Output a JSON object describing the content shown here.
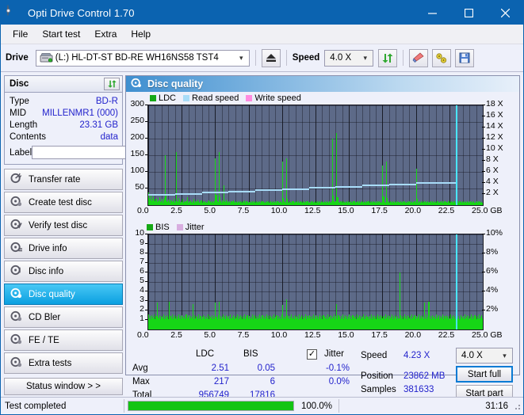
{
  "window": {
    "title": "Opti Drive Control 1.70",
    "icon": "disc-icon",
    "minimize": "minimize",
    "maximize": "maximize",
    "close": "close"
  },
  "menu": [
    "File",
    "Start test",
    "Extra",
    "Help"
  ],
  "toolbar": {
    "drive_label": "Drive",
    "drive_value": "(L:)  HL-DT-ST BD-RE  WH16NS58 TST4",
    "eject": "eject",
    "speed_label": "Speed",
    "speed_value": "4.0 X",
    "refresh": "refresh",
    "erase": "erase",
    "tools": "tools",
    "save": "save"
  },
  "disc_panel": {
    "title": "Disc",
    "refresh": "refresh",
    "rows": [
      {
        "key": "Type",
        "value": "BD-R"
      },
      {
        "key": "MID",
        "value": "MILLENMR1 (000)"
      },
      {
        "key": "Length",
        "value": "23.31 GB"
      },
      {
        "key": "Contents",
        "value": "data"
      }
    ],
    "label_key": "Label",
    "label_value": "",
    "label_placeholder": ""
  },
  "nav": [
    {
      "label": "Transfer rate",
      "selected": false
    },
    {
      "label": "Create test disc",
      "selected": false
    },
    {
      "label": "Verify test disc",
      "selected": false
    },
    {
      "label": "Drive info",
      "selected": false
    },
    {
      "label": "Disc info",
      "selected": false
    },
    {
      "label": "Disc quality",
      "selected": true
    },
    {
      "label": "CD Bler",
      "selected": false
    },
    {
      "label": "FE / TE",
      "selected": false
    },
    {
      "label": "Extra tests",
      "selected": false
    }
  ],
  "status_window_button": "Status window > >",
  "main": {
    "title": "Disc quality"
  },
  "stats": {
    "col_ldc": "LDC",
    "col_bis": "BIS",
    "jitter_label": "Jitter",
    "jitter_checked": true,
    "rows": [
      {
        "label": "Avg",
        "ldc": "2.51",
        "bis": "0.05",
        "jitter": "-0.1%"
      },
      {
        "label": "Max",
        "ldc": "217",
        "bis": "6",
        "jitter": "0.0%"
      },
      {
        "label": "Total",
        "ldc": "956749",
        "bis": "17816",
        "jitter": ""
      }
    ],
    "speed_label": "Speed",
    "speed_value": "4.23 X",
    "position_label": "Position",
    "position_value": "23862 MB",
    "samples_label": "Samples",
    "samples_value": "381633",
    "speed_select": "4.0 X",
    "start_full": "Start full",
    "start_part": "Start part"
  },
  "statusbar": {
    "message": "Test completed",
    "percent_text": "100.0%",
    "percent_value": 100,
    "elapsed": "31:16"
  },
  "colors": {
    "accent": "#0b63b0",
    "ldc": "#16d616",
    "bis": "#16d616",
    "read_speed": "#a8dcf8",
    "write_speed": "#ff8ce0",
    "jitter": "#d8aee0",
    "plot_bg": "#5d6a88",
    "cursor": "#49e6ff",
    "value_text": "#2222cc",
    "progress": "#13c413"
  },
  "chart_data": [
    {
      "type": "bar",
      "name": "ldc-chart",
      "title": "",
      "xlabel": "GB",
      "ylabel": "",
      "legend": [
        {
          "label": "LDC",
          "color": "#16d616"
        },
        {
          "label": "Read speed",
          "color": "#a8dcf8"
        },
        {
          "label": "Write speed",
          "color": "#ff8ce0"
        }
      ],
      "legend_position": "top-left",
      "grid": true,
      "xlim": [
        0.0,
        25.0
      ],
      "ylim": [
        0,
        300
      ],
      "xticks": [
        "0.0",
        "2.5",
        "5.0",
        "7.5",
        "10.0",
        "12.5",
        "15.0",
        "17.5",
        "20.0",
        "22.5",
        "25.0"
      ],
      "xtick_values": [
        0.0,
        2.5,
        5.0,
        7.5,
        10.0,
        12.5,
        15.0,
        17.5,
        20.0,
        22.5,
        25.0
      ],
      "x_unit": "GB",
      "yticks": [
        "300",
        "250",
        "200",
        "150",
        "100",
        "50"
      ],
      "ytick_values": [
        300,
        250,
        200,
        150,
        100,
        50
      ],
      "y2label": "",
      "y2lim": [
        0,
        18
      ],
      "y2ticks": [
        "18 X",
        "16 X",
        "14 X",
        "12 X",
        "10 X",
        "8 X",
        "6 X",
        "4 X",
        "2 X"
      ],
      "y2tick_values": [
        18,
        16,
        14,
        12,
        10,
        8,
        6,
        4,
        2
      ],
      "cursor_x": 23.0,
      "series": [
        {
          "name": "LDC",
          "color": "#16d616",
          "values": [
            38,
            22,
            16,
            30,
            12,
            18,
            26,
            14,
            11,
            20,
            9,
            15,
            13,
            24,
            10,
            12,
            19,
            8,
            14,
            22,
            150,
            28,
            12,
            9,
            17,
            11,
            8,
            14,
            10,
            12,
            19,
            7,
            13,
            160,
            11,
            9,
            22,
            14,
            8,
            12,
            10,
            18,
            7,
            13,
            9,
            11,
            25,
            8,
            12,
            10,
            14,
            9,
            7,
            12,
            19,
            8,
            11,
            13,
            9,
            16,
            12,
            7,
            10,
            14,
            8,
            11,
            9,
            13,
            7,
            10,
            8,
            12,
            15,
            9,
            11,
            7,
            10,
            13,
            8,
            12,
            140,
            30,
            12,
            9,
            160,
            25,
            11,
            8,
            14,
            10,
            60,
            12,
            9,
            16,
            11,
            8,
            13,
            10,
            7,
            12,
            9,
            14,
            11,
            8,
            10,
            12,
            7,
            9,
            13,
            8,
            11,
            10,
            7,
            12,
            9,
            14,
            8,
            11,
            9,
            7,
            10,
            12,
            8,
            9,
            11,
            7,
            13,
            10,
            8,
            12,
            9,
            7,
            11,
            10,
            8,
            13,
            9,
            12,
            7,
            10,
            8,
            11,
            9,
            13,
            7,
            10,
            12,
            8,
            9,
            11,
            7,
            10,
            13,
            8,
            12,
            9,
            7,
            11,
            10,
            8,
            130,
            22,
            9,
            11,
            7,
            140,
            18,
            10,
            8,
            12,
            9,
            7,
            11,
            13,
            8,
            10,
            9,
            12,
            7,
            11,
            8,
            10,
            13,
            9,
            7,
            12,
            10,
            8,
            11,
            9,
            13,
            7,
            10,
            8,
            12,
            9,
            11,
            7,
            10,
            13,
            8,
            9,
            12,
            7,
            11,
            10,
            8,
            13,
            9,
            7,
            12,
            10,
            8,
            11,
            9,
            7,
            13,
            10,
            8,
            12,
            200,
            28,
            12,
            9,
            11,
            217,
            24,
            10,
            8,
            13,
            9,
            11,
            7,
            12,
            10,
            8,
            9,
            13,
            7,
            11,
            10,
            8,
            12,
            9,
            7,
            11,
            13,
            8,
            10,
            9,
            12,
            7,
            11,
            8,
            10,
            13,
            9,
            7,
            12,
            10,
            8,
            11,
            9,
            13,
            7,
            10,
            12,
            8,
            9,
            11,
            10,
            7,
            13,
            8,
            12,
            9,
            11,
            7,
            10,
            8,
            120,
            26,
            10,
            8,
            130,
            22,
            9,
            12,
            7,
            11,
            10,
            8,
            13,
            9,
            7,
            12,
            10,
            8,
            11,
            9,
            7,
            13,
            10,
            8,
            12,
            9,
            11,
            7,
            10,
            8,
            13,
            9,
            12,
            7,
            11,
            10,
            8,
            9,
            13,
            7,
            110,
            20,
            8,
            11,
            9,
            7,
            13,
            10,
            8,
            12,
            9,
            11,
            7,
            10,
            13,
            8,
            9,
            12,
            7,
            11,
            10,
            8,
            13,
            9,
            7,
            12,
            11,
            8,
            10,
            9,
            13,
            7,
            11,
            8,
            12,
            10,
            9,
            7,
            13,
            11,
            8,
            10,
            12,
            9,
            7,
            11,
            13,
            8,
            10,
            9,
            12,
            7,
            11,
            10,
            8,
            13,
            9,
            7,
            12,
            10,
            8,
            11,
            9,
            7,
            13,
            10,
            12,
            8,
            9,
            11,
            7,
            10,
            13,
            8,
            12,
            9,
            11,
            7,
            10,
            8
          ]
        },
        {
          "name": "Read speed",
          "color": "#a8dcf8",
          "note": "stepped CAV read curve rising from about 2.0 X to about 4.3 X",
          "x": [
            0.0,
            2.0,
            4.0,
            6.0,
            8.0,
            10.0,
            12.0,
            14.0,
            16.0,
            18.0,
            20.0,
            22.0,
            23.0
          ],
          "values": [
            2.0,
            2.2,
            2.4,
            2.6,
            2.8,
            3.0,
            3.3,
            3.5,
            3.7,
            3.9,
            4.1,
            4.2,
            4.23
          ]
        }
      ]
    },
    {
      "type": "bar",
      "name": "bis-chart",
      "title": "",
      "xlabel": "GB",
      "ylabel": "",
      "legend": [
        {
          "label": "BIS",
          "color": "#16d616"
        },
        {
          "label": "Jitter",
          "color": "#d8aee0"
        }
      ],
      "legend_position": "top-left",
      "grid": true,
      "xlim": [
        0.0,
        25.0
      ],
      "ylim": [
        0,
        10
      ],
      "xticks": [
        "0.0",
        "2.5",
        "5.0",
        "7.5",
        "10.0",
        "12.5",
        "15.0",
        "17.5",
        "20.0",
        "22.5",
        "25.0"
      ],
      "xtick_values": [
        0.0,
        2.5,
        5.0,
        7.5,
        10.0,
        12.5,
        15.0,
        17.5,
        20.0,
        22.5,
        25.0
      ],
      "x_unit": "GB",
      "yticks": [
        "10",
        "9",
        "8",
        "7",
        "6",
        "5",
        "4",
        "3",
        "2",
        "1"
      ],
      "ytick_values": [
        10,
        9,
        8,
        7,
        6,
        5,
        4,
        3,
        2,
        1
      ],
      "y2lim": [
        0,
        10
      ],
      "y2ticks": [
        "10%",
        "8%",
        "6%",
        "4%",
        "2%"
      ],
      "y2tick_values": [
        10,
        8,
        6,
        4,
        2
      ],
      "cursor_x": 23.0,
      "series": [
        {
          "name": "BIS",
          "color": "#16d616",
          "values": [
            1.6,
            1.2,
            1.4,
            1.1,
            1.5,
            1.3,
            1.2,
            1.6,
            1.1,
            1.4,
            2.8,
            1.3,
            1.2,
            1.5,
            1.1,
            1.4,
            1.3,
            1.2,
            1.6,
            1.1,
            1.4,
            1.2,
            1.5,
            1.3,
            1.1,
            2.9,
            1.4,
            1.2,
            1.6,
            1.1,
            1.3,
            1.5,
            1.2,
            1.4,
            1.1,
            1.3,
            1.6,
            1.2,
            1.4,
            1.1,
            1.5,
            1.3,
            1.2,
            1.4,
            1.1,
            1.6,
            1.2,
            1.3,
            1.5,
            1.1,
            1.4,
            1.2,
            1.3,
            2.7,
            1.1,
            1.5,
            1.2,
            1.4,
            1.3,
            1.1,
            1.6,
            1.2,
            1.4,
            1.1,
            1.3,
            1.5,
            1.2,
            1.4,
            1.1,
            1.3,
            1.2,
            1.6,
            1.1,
            1.4,
            1.3,
            1.2,
            1.5,
            1.1,
            1.4,
            1.2,
            2.8,
            1.3,
            1.1,
            1.5,
            2.9,
            1.2,
            1.4,
            1.1,
            1.3,
            1.6,
            1.2,
            1.4,
            1.1,
            1.5,
            1.3,
            1.2,
            1.4,
            1.1,
            1.6,
            1.2,
            1.3,
            1.5,
            1.1,
            1.4,
            1.2,
            1.3,
            1.6,
            1.1,
            1.4,
            1.2,
            1.5,
            1.3,
            1.1,
            1.4,
            1.2,
            1.6,
            1.1,
            1.3,
            1.5,
            1.2,
            1.4,
            1.1,
            1.3,
            1.2,
            1.6,
            1.1,
            1.4,
            1.5,
            1.2,
            1.3,
            1.1,
            1.4,
            1.2,
            1.6,
            1.3,
            1.1,
            1.5,
            1.2,
            1.4,
            1.1,
            1.3,
            1.6,
            1.2,
            1.4,
            1.1,
            1.5,
            1.3,
            1.2,
            1.4,
            1.1,
            1.6,
            1.2,
            1.3,
            1.5,
            1.1,
            1.4,
            1.2,
            1.3,
            1.1,
            1.6,
            2.6,
            1.2,
            1.4,
            1.1,
            1.3,
            3.2,
            1.5,
            1.2,
            1.4,
            1.1,
            1.3,
            1.6,
            1.2,
            1.4,
            1.1,
            1.5,
            1.3,
            1.2,
            1.4,
            1.1,
            1.6,
            1.2,
            1.3,
            1.5,
            1.1,
            1.4,
            1.2,
            1.3,
            1.6,
            1.1,
            1.4,
            1.2,
            1.5,
            1.3,
            1.1,
            1.4,
            1.2,
            1.6,
            1.1,
            1.3,
            1.5,
            1.2,
            1.4,
            1.1,
            1.3,
            1.6,
            1.2,
            1.4,
            1.1,
            1.5,
            1.3,
            1.2,
            1.4,
            1.1,
            1.6,
            1.2,
            1.3,
            1.5,
            1.1,
            1.4,
            1.2,
            1.3,
            1.6,
            1.1,
            1.4,
            2.7,
            1.2,
            1.5,
            1.3,
            1.1,
            1.4,
            1.2,
            1.6,
            1.1,
            1.3,
            1.5,
            1.2,
            1.4,
            1.1,
            1.3,
            1.6,
            1.2,
            1.4,
            1.1,
            1.5,
            1.3,
            1.2,
            1.4,
            1.1,
            1.6,
            1.2,
            1.3,
            1.5,
            1.1,
            1.4,
            1.2,
            1.3,
            1.6,
            1.1,
            1.4,
            1.2,
            1.5,
            1.3,
            1.1,
            1.4,
            1.2,
            1.6,
            1.1,
            1.3,
            1.5,
            1.2,
            1.4,
            1.1,
            1.3,
            1.6,
            1.2,
            1.4,
            1.1,
            1.5,
            1.3,
            1.2,
            1.4,
            1.1,
            1.6,
            1.2,
            1.3,
            1.5,
            1.1,
            1.4,
            1.2,
            1.3,
            1.6,
            1.1,
            1.4,
            1.2,
            1.5,
            1.3,
            1.1,
            1.4,
            1.2,
            6.0,
            1.5,
            1.2,
            1.4,
            1.1,
            1.3,
            1.6,
            1.2,
            1.4,
            1.1,
            1.5,
            1.3,
            1.2,
            1.4,
            1.1,
            1.6,
            1.2,
            1.3,
            1.5,
            1.1,
            1.4,
            1.2,
            1.3,
            1.6,
            1.1,
            1.4,
            1.2,
            1.5,
            1.3,
            1.1,
            2.8,
            1.2,
            1.6,
            1.1,
            1.3,
            2.9,
            1.2,
            1.4,
            1.1,
            1.5,
            1.3,
            1.2,
            1.4,
            1.1,
            1.6,
            1.2,
            1.3,
            1.5,
            1.1,
            1.4,
            1.2,
            1.3,
            1.6,
            1.1,
            1.4,
            1.2,
            1.5,
            1.3,
            1.1,
            1.4,
            1.2,
            1.6,
            1.1,
            1.3,
            1.5,
            1.2,
            1.4,
            1.1,
            1.3,
            1.6,
            1.2,
            1.4,
            1.1,
            1.5,
            1.3,
            1.2,
            1.4,
            1.1,
            1.6,
            1.2,
            1.3,
            1.5,
            1.1,
            1.4,
            1.2,
            1.3,
            1.6,
            1.1,
            1.4,
            1.2,
            1.5,
            1.3,
            1.1,
            1.4,
            1.2,
            1.6,
            1.1,
            1.3,
            1.5,
            1.2
          ]
        }
      ]
    }
  ]
}
